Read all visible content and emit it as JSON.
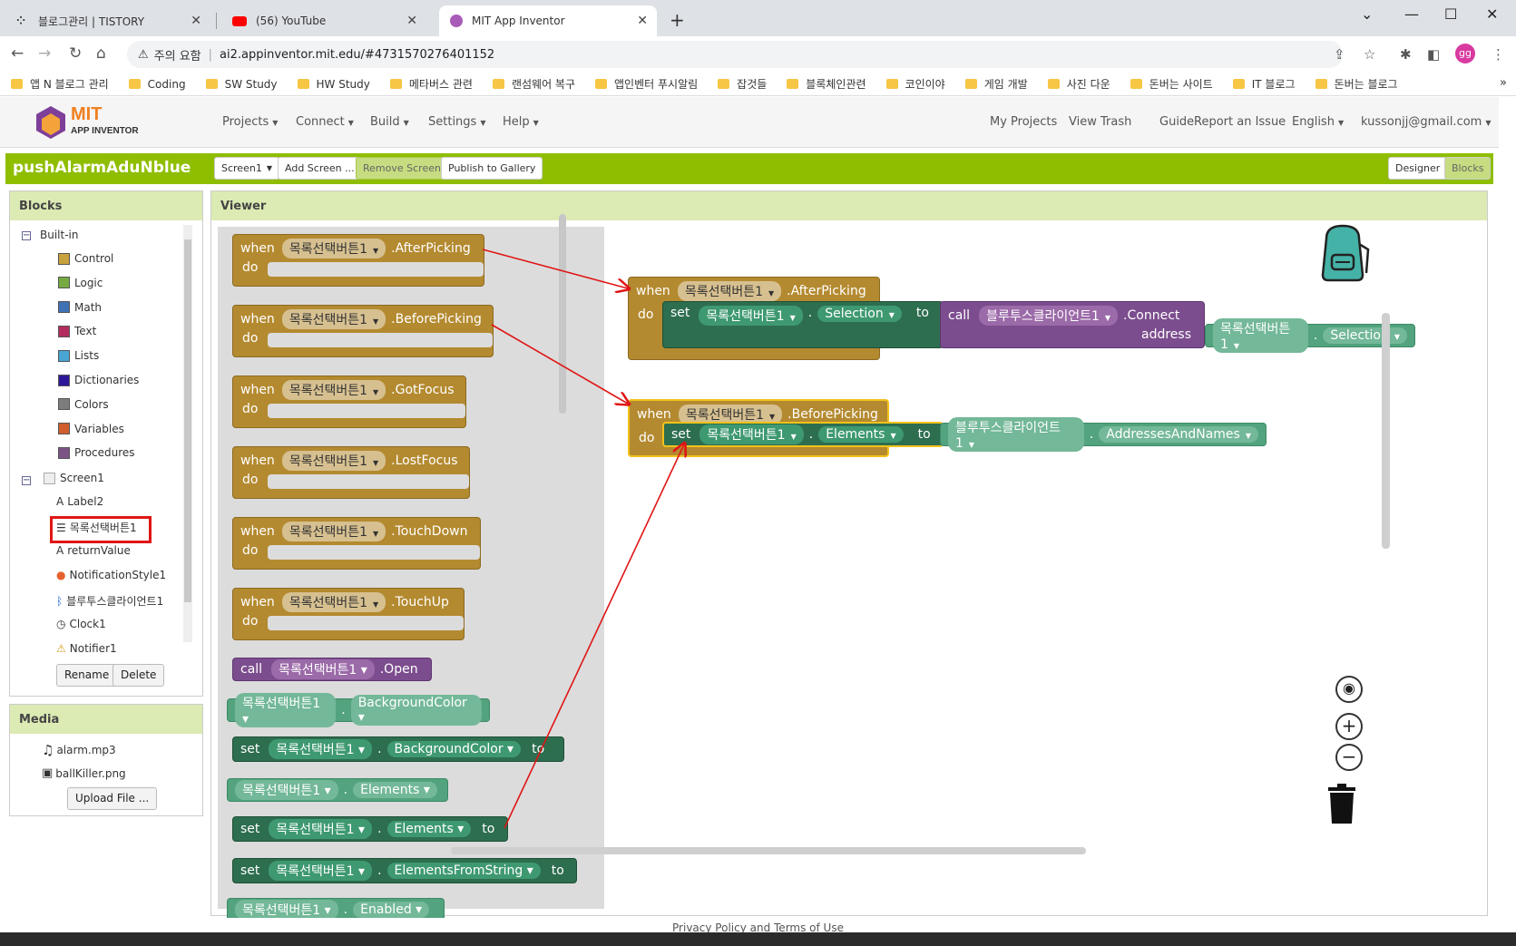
{
  "browser": {
    "tabs": [
      {
        "title": "블로그관리 | TISTORY",
        "active": false
      },
      {
        "title": "(56) YouTube",
        "active": false
      },
      {
        "title": "MIT App Inventor",
        "active": true
      }
    ],
    "security_label": "주의 요함",
    "url": "ai2.appinventor.mit.edu/#4731570276401152",
    "profile": "gg",
    "bookmarks": [
      "앱 N 블로그 관리",
      "Coding",
      "SW Study",
      "HW Study",
      "메타버스 관련",
      "랜섬웨어 복구",
      "앱인벤터 푸시알림",
      "잡것들",
      "블록체인관련",
      "코인이야",
      "게임 개발",
      "사진 다운",
      "돈버는 사이트",
      "IT 블로그",
      "돈버는 블로그"
    ],
    "bookmark_more": "»"
  },
  "app": {
    "logo_mit": "MIT",
    "logo_sub": "APP INVENTOR",
    "menus": [
      "Projects",
      "Connect",
      "Build",
      "Settings",
      "Help"
    ],
    "right_menus": [
      "My Projects",
      "View Trash",
      "Guide",
      "Report an Issue",
      "English",
      "kussonjj@gmail.com"
    ],
    "project_name": "pushAlarmAduNblue",
    "screen_select": "Screen1",
    "add_screen": "Add Screen ...",
    "remove_screen": "Remove Screen",
    "publish": "Publish to Gallery",
    "designer": "Designer",
    "blocks": "Blocks"
  },
  "blocks_panel": {
    "title": "Blocks",
    "builtin_label": "Built-in",
    "builtin": [
      {
        "label": "Control",
        "color": "#c8a23c"
      },
      {
        "label": "Logic",
        "color": "#77ab41"
      },
      {
        "label": "Math",
        "color": "#3f71b5"
      },
      {
        "label": "Text",
        "color": "#b32d5e"
      },
      {
        "label": "Lists",
        "color": "#49a6d4"
      },
      {
        "label": "Dictionaries",
        "color": "#2d1799"
      },
      {
        "label": "Colors",
        "color": "#7d7d7d"
      },
      {
        "label": "Variables",
        "color": "#d05f2d"
      },
      {
        "label": "Procedures",
        "color": "#7c5385"
      }
    ],
    "screen_label": "Screen1",
    "components": [
      "Label2",
      "목록선택버튼1",
      "returnValue",
      "NotificationStyle1",
      "블루투스클라이언트1",
      "Clock1",
      "Notifier1"
    ],
    "rename": "Rename",
    "delete": "Delete"
  },
  "media_panel": {
    "title": "Media",
    "files": [
      "alarm.mp3",
      "ballKiller.png"
    ],
    "upload": "Upload File ..."
  },
  "viewer": {
    "title": "Viewer",
    "flyout": {
      "events": [
        {
          "kw": "when",
          "comp": "목록선택버튼1",
          "event": ".AfterPicking",
          "do": "do"
        },
        {
          "kw": "when",
          "comp": "목록선택버튼1",
          "event": ".BeforePicking",
          "do": "do"
        },
        {
          "kw": "when",
          "comp": "목록선택버튼1",
          "event": ".GotFocus",
          "do": "do"
        },
        {
          "kw": "when",
          "comp": "목록선택버튼1",
          "event": ".LostFocus",
          "do": "do"
        },
        {
          "kw": "when",
          "comp": "목록선택버튼1",
          "event": ".TouchDown",
          "do": "do"
        },
        {
          "kw": "when",
          "comp": "목록선택버튼1",
          "event": ".TouchUp",
          "do": "do"
        }
      ],
      "call_open": {
        "kw": "call",
        "comp": "목록선택버튼1",
        "method": ".Open"
      },
      "props": [
        {
          "type": "get",
          "comp": "목록선택버튼1",
          "prop": "BackgroundColor"
        },
        {
          "type": "set",
          "kw": "set",
          "comp": "목록선택버튼1",
          "prop": "BackgroundColor",
          "to": "to"
        },
        {
          "type": "get",
          "comp": "목록선택버튼1",
          "prop": "Elements"
        },
        {
          "type": "set",
          "kw": "set",
          "comp": "목록선택버튼1",
          "prop": "Elements",
          "to": "to"
        },
        {
          "type": "set",
          "kw": "set",
          "comp": "목록선택버튼1",
          "prop": "ElementsFromString",
          "to": "to"
        },
        {
          "type": "get",
          "comp": "목록선택버튼1",
          "prop": "Enabled"
        }
      ]
    },
    "workspace": {
      "block1": {
        "kw": "when",
        "comp": "목록선택버튼1",
        "event": ".AfterPicking",
        "do": "do",
        "set_kw": "set",
        "set_comp": "목록선택버튼1",
        "set_prop": "Selection",
        "to": "to",
        "call_kw": "call",
        "call_comp": "블루투스클라이언트1",
        "call_method": ".Connect",
        "address": "address",
        "addr_comp": "목록선택버튼1",
        "addr_prop": "Selection"
      },
      "block2": {
        "kw": "when",
        "comp": "목록선택버튼1",
        "event": ".BeforePicking",
        "do": "do",
        "set_kw": "set",
        "set_comp": "목록선택버튼1",
        "set_prop": "Elements",
        "to": "to",
        "val_comp": "블루투스클라이언트1",
        "val_prop": "AddressesAndNames"
      }
    }
  },
  "footer": "Privacy Policy and Terms of Use"
}
